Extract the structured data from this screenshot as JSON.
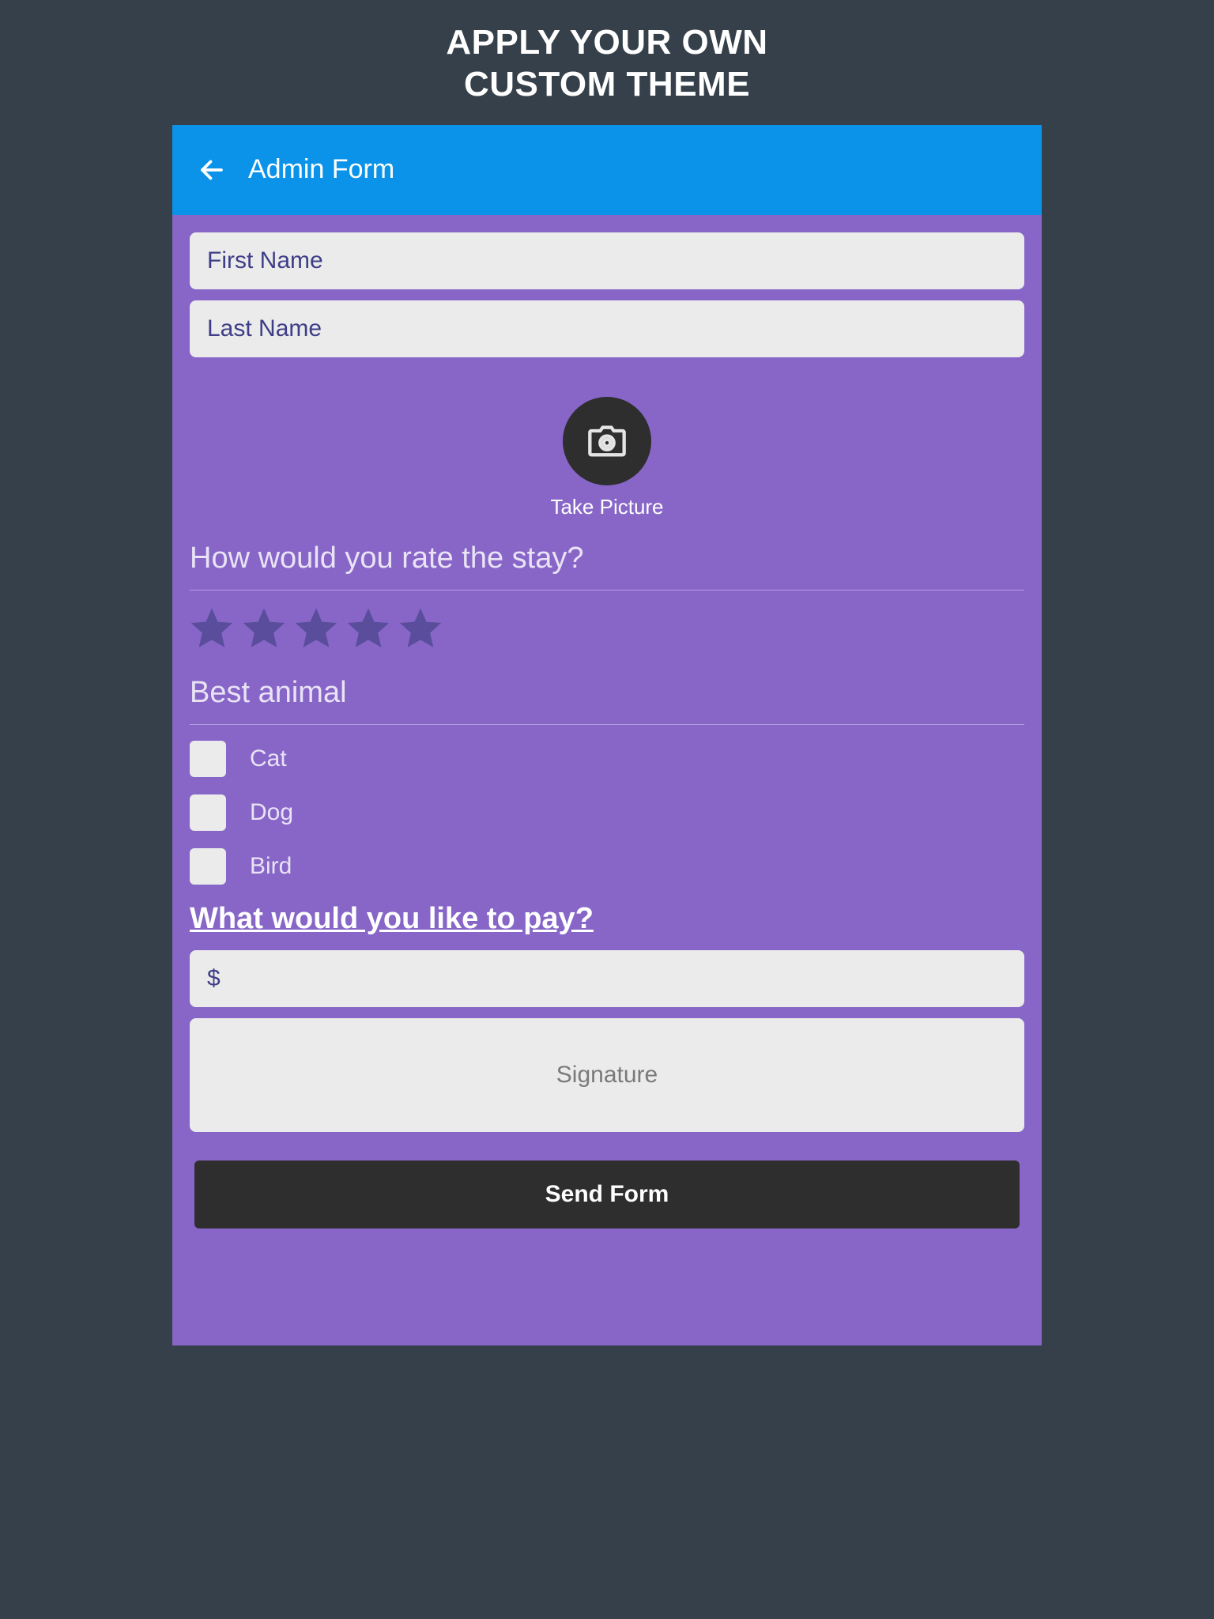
{
  "promo": {
    "line1": "APPLY YOUR OWN",
    "line2": "CUSTOM THEME"
  },
  "appbar": {
    "title": "Admin Form"
  },
  "fields": {
    "first_name_placeholder": "First Name",
    "last_name_placeholder": "Last Name",
    "take_picture_label": "Take Picture",
    "rating_question": "How would you rate the stay?",
    "best_animal_question": "Best animal",
    "animals": [
      "Cat",
      "Dog",
      "Bird"
    ],
    "pay_question": "What would you like to pay?",
    "currency_placeholder": "$",
    "signature_label": "Signature"
  },
  "actions": {
    "send_label": "Send Form"
  },
  "rating": {
    "max_stars": 5,
    "value": 0
  }
}
